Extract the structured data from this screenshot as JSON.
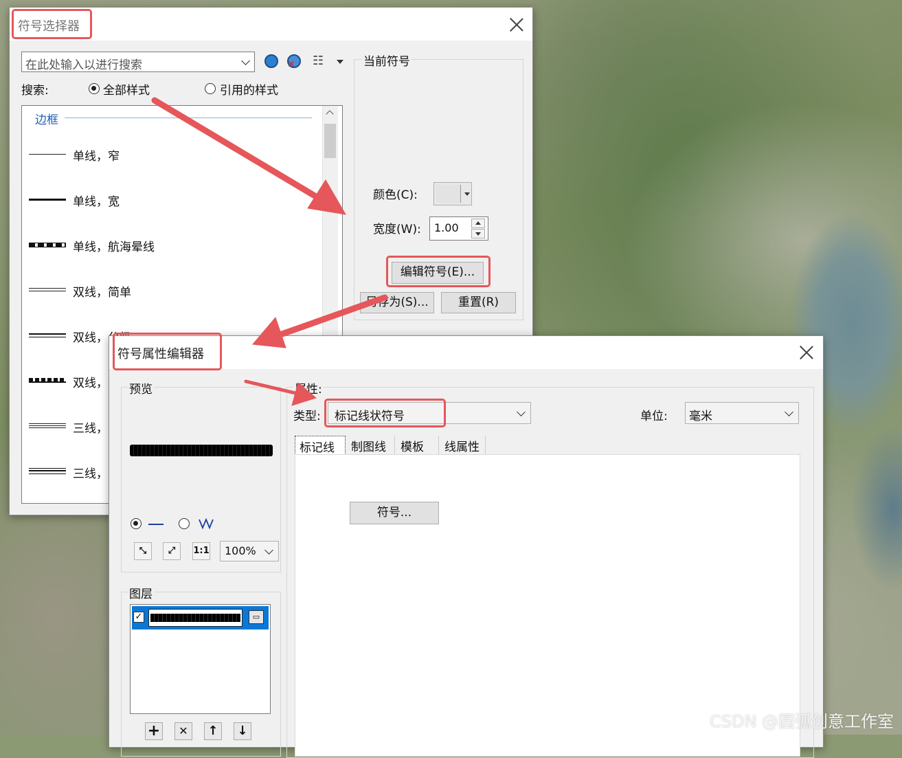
{
  "watermark": "CSDN @圆弧创意工作室",
  "selector": {
    "title": "符号选择器",
    "search_placeholder": "在此处输入以进行搜索",
    "search_label": "搜索:",
    "radio_all": "全部样式",
    "radio_referenced": "引用的样式",
    "category": "边框",
    "items": [
      "单线，窄",
      "单线，宽",
      "单线，航海晕线",
      "双线，简单",
      "双线，分级",
      "双线，",
      "三线，",
      "三线，"
    ],
    "current_symbol_label": "当前符号",
    "color_label": "颜色(C):",
    "width_label": "宽度(W):",
    "width_value": "1.00",
    "edit_symbol_button": "编辑符号(E)...",
    "save_as_button": "另存为(S)...",
    "reset_button": "重置(R)"
  },
  "editor": {
    "title": "符号属性编辑器",
    "preview_label": "预览",
    "zoom_value": "100%",
    "layers_label": "图层",
    "properties_label": "属性:",
    "type_label": "类型:",
    "type_value": "标记线状符号",
    "unit_label": "单位:",
    "unit_value": "毫米",
    "tabs": [
      "标记线",
      "制图线",
      "模板",
      "线属性"
    ],
    "symbol_button": "符号..."
  }
}
